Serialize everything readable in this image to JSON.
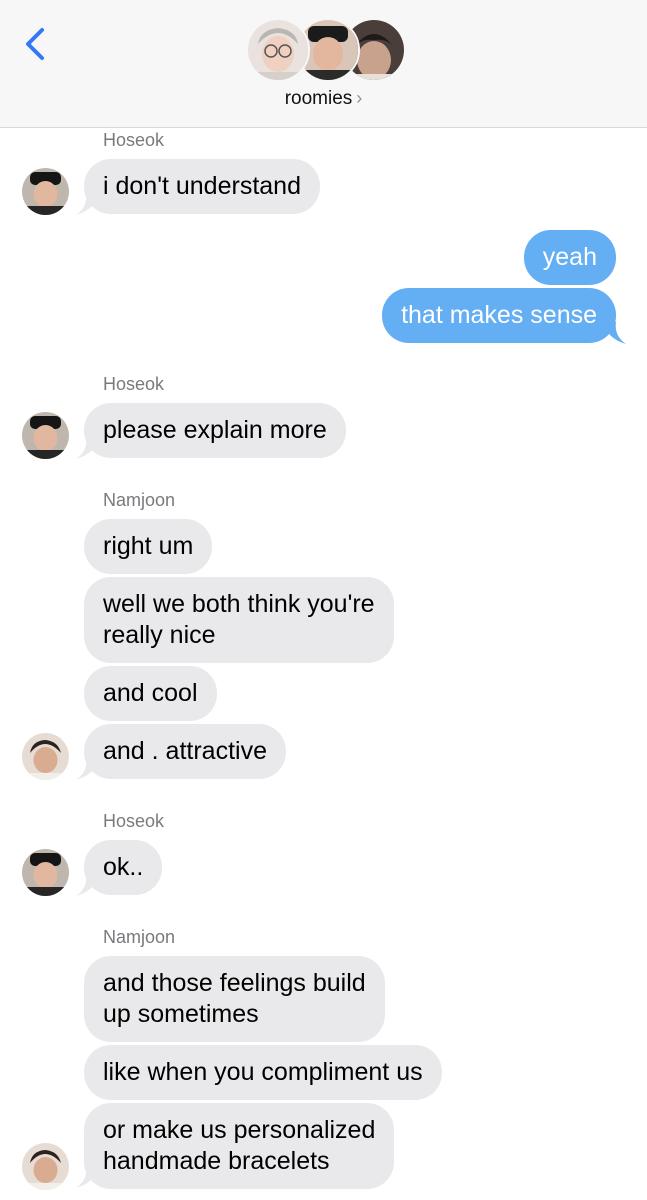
{
  "header": {
    "group_name": "roomies",
    "chevron": "›",
    "back_icon": "chevron-left-icon",
    "accent_color": "#3478f6"
  },
  "messages": [
    {
      "sender": "Hoseok",
      "text": "i don't understand"
    },
    {
      "outgoing": true,
      "text": "yeah"
    },
    {
      "outgoing": true,
      "text": "that makes sense"
    },
    {
      "sender": "Hoseok",
      "text": "please explain more"
    },
    {
      "sender": "Namjoon",
      "text": "right um"
    },
    {
      "text_line1": "well we both think you're",
      "text_line2": "really nice"
    },
    {
      "text": "and cool"
    },
    {
      "text": "and . attractive"
    },
    {
      "sender": "Hoseok",
      "text": "ok.."
    },
    {
      "sender": "Namjoon",
      "text_line1": "and those feelings build",
      "text_line2": "up sometimes"
    },
    {
      "text": "like when you compliment us"
    },
    {
      "text_line1": "or make us personalized",
      "text_line2": "handmade bracelets"
    }
  ],
  "colors": {
    "incoming_bubble": "#e9e9eb",
    "outgoing_bubble": "#64aef3",
    "sender_label": "#7a7a7e"
  }
}
